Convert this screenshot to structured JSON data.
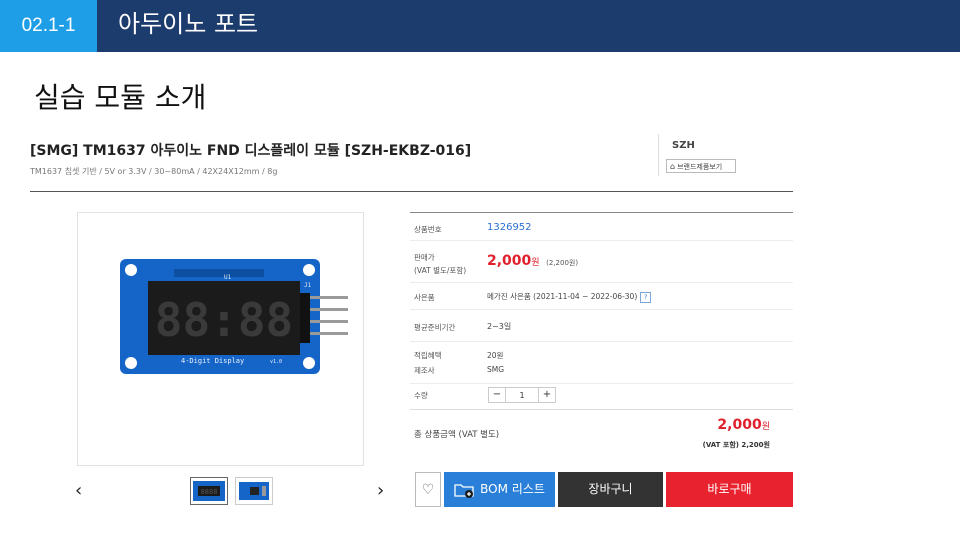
{
  "header": {
    "section_number": "02.1-1",
    "section_title": "아두이노 포트"
  },
  "slide_title": "실습 모듈 소개",
  "product": {
    "title": "[SMG] TM1637 아두이노 FND 디스플레이 모듈 [SZH-EKBZ-016]",
    "subtitle": "TM1637 칩셋 기반 / 5V or 3.3V / 30~80mA / 42X24X12mm / 8g",
    "brand": "SZH",
    "brand_button": "브랜드제품보기",
    "image_silk": {
      "label": "4-Digit Display",
      "version": "v1.0",
      "u1": "U1",
      "j1": "J1",
      "digits": "88:88"
    }
  },
  "gallery": {
    "prev": "‹",
    "next": "›",
    "thumb_digits": "8888"
  },
  "info": {
    "product_number_label": "상품번호",
    "product_number": "1326952",
    "price_label_line1": "판매가",
    "price_label_line2": "(VAT 별도/포함)",
    "price": "2,000",
    "price_unit": "원",
    "price_vat": "(2,200원)",
    "promo_label": "사은품",
    "promo_text": "메가진 사은품 (2021-11-04 ~ 2022-06-30)",
    "promo_icon": "?",
    "lead_time_label": "평균준비기간",
    "lead_time": "2~3일",
    "points_label": "적립혜택",
    "points": "20원",
    "maker_label": "제조사",
    "maker": "SMG",
    "qty_label": "수량",
    "qty_minus": "−",
    "qty_value": "1",
    "qty_plus": "+"
  },
  "total": {
    "label": "총 상품금액 (VAT 별도)",
    "price": "2,000",
    "unit": "원",
    "vat_label": "(VAT 포함)",
    "vat_price": "2,200원"
  },
  "buttons": {
    "heart": "♡",
    "bom": "BOM 리스트",
    "cart": "장바구니",
    "buy": "바로구매"
  }
}
